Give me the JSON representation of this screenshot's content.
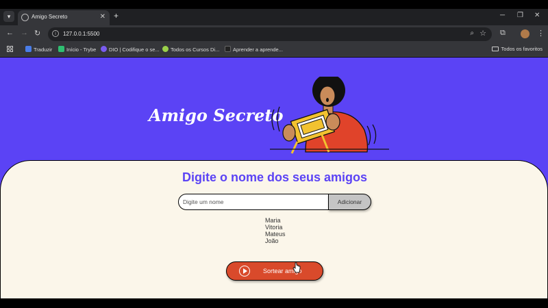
{
  "browser": {
    "tab_title": "Amigo Secreto",
    "tab_close": "✕",
    "new_tab": "+",
    "url": "127.0.0.1:5500",
    "bookmarks": [
      {
        "label": "Traduzir",
        "color": "#4a7de8"
      },
      {
        "label": "Início - Trybe",
        "color": "#2fbf71"
      },
      {
        "label": "DIO | Codifique o se...",
        "color": "#7a5cf0"
      },
      {
        "label": "Todos os Cursos Di...",
        "color": "#9ad04a"
      },
      {
        "label": "Aprender a aprende...",
        "color": "#222222"
      }
    ],
    "favorites": "Todos os favoritos"
  },
  "page": {
    "hero_title": "Amigo Secreto",
    "heading": "Digite o nome dos seus amigos",
    "input_placeholder": "Digite um nome",
    "add_button": "Adicionar",
    "friends": [
      "Maria",
      "Vitoria",
      "Mateus",
      "João"
    ],
    "draw_button": "Sortear amigo"
  },
  "colors": {
    "primary": "#5b43f5",
    "card_bg": "#fbf6ea",
    "draw_button": "#d94a2b"
  }
}
